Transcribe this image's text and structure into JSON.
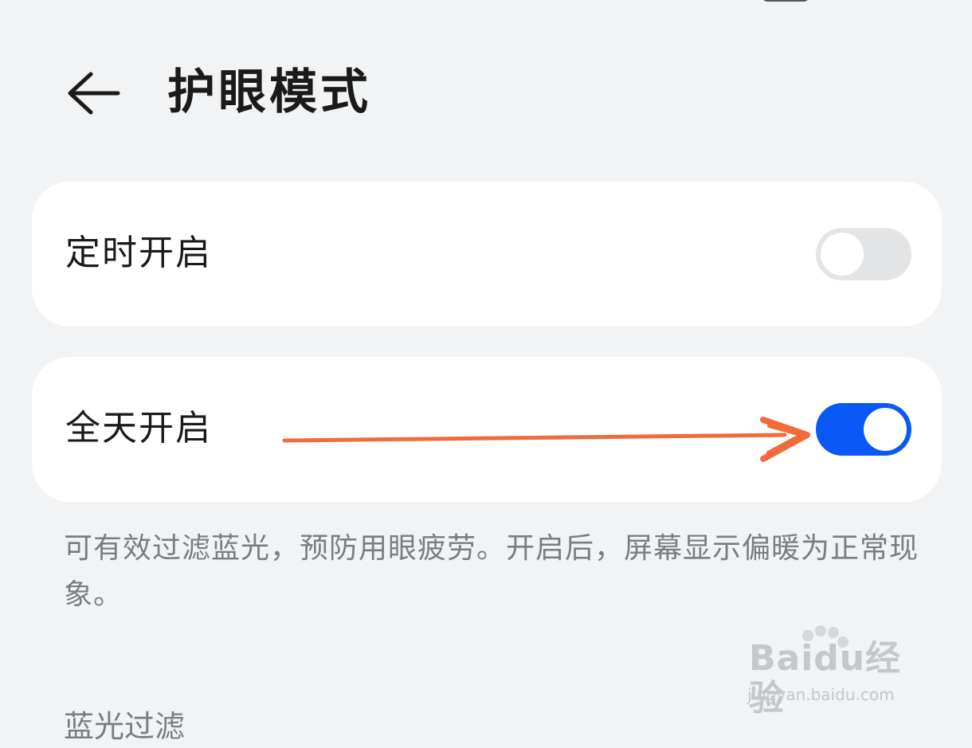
{
  "header": {
    "title": "护眼模式"
  },
  "settings": [
    {
      "label": "定时开启",
      "enabled": false
    },
    {
      "label": "全天开启",
      "enabled": true
    }
  ],
  "description": "可有效过滤蓝光，预防用眼疲劳。开启后，屏幕显示偏暖为正常现象。",
  "section_title": "蓝光过滤",
  "watermark": {
    "logo_text": "Baidu经验",
    "url": "jingyan.baidu.com"
  },
  "colors": {
    "toggle_on": "#0a59f7",
    "toggle_off": "#e3e4e6",
    "annotation_arrow": "#f26b3a",
    "background": "#f1f3f5"
  }
}
